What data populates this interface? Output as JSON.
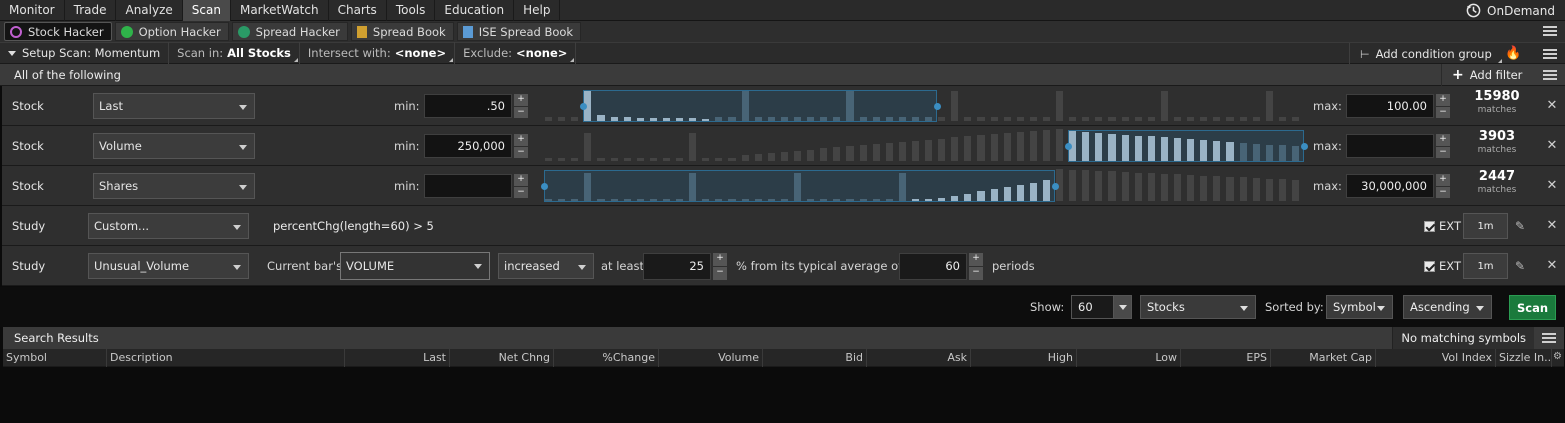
{
  "nav": {
    "tabs": [
      "Monitor",
      "Trade",
      "Analyze",
      "Scan",
      "MarketWatch",
      "Charts",
      "Tools",
      "Education",
      "Help"
    ],
    "active": "Scan",
    "ondemand": "OnDemand"
  },
  "subtabs": [
    {
      "label": "Stock Hacker",
      "icon": "stock-hacker-icon",
      "color": "#c060d0",
      "active": true
    },
    {
      "label": "Option Hacker",
      "icon": "option-hacker-icon",
      "color": "#2fb34a",
      "active": false
    },
    {
      "label": "Spread Hacker",
      "icon": "spread-hacker-icon",
      "color": "#2a9a66",
      "active": false
    },
    {
      "label": "Spread Book",
      "icon": "spread-book-icon",
      "color": "#d0a030",
      "active": false
    },
    {
      "label": "ISE Spread Book",
      "icon": "ise-spread-book-icon",
      "color": "#5b9bd5",
      "active": false
    }
  ],
  "setup": {
    "setup_label": "Setup Scan: Momentum",
    "scan_in_label": "Scan in:",
    "scan_in_value": "All Stocks",
    "intersect_label": "Intersect with:",
    "intersect_value": "<none>",
    "exclude_label": "Exclude:",
    "exclude_value": "<none>",
    "add_condition_group": "Add condition group"
  },
  "conditions_header": {
    "label": "All of the following",
    "add_filter": "Add filter"
  },
  "filters": [
    {
      "type": "Stock",
      "field": "Last",
      "min_label": "min:",
      "min": ".50",
      "max_label": "max:",
      "max": "100.00",
      "matches": "15980",
      "matches_label": "matches"
    },
    {
      "type": "Stock",
      "field": "Volume",
      "min_label": "min:",
      "min": "250,000",
      "max_label": "max:",
      "max": "",
      "matches": "3903",
      "matches_label": "matches"
    },
    {
      "type": "Stock",
      "field": "Shares",
      "min_label": "min:",
      "min": "",
      "max_label": "max:",
      "max": "30,000,000",
      "matches": "2447",
      "matches_label": "matches"
    }
  ],
  "studies": [
    {
      "type": "Study",
      "name": "Custom...",
      "formula": "percentChg(length=60) > 5",
      "ext": "EXT",
      "timeframe": "1m"
    },
    {
      "type": "Study",
      "name": "Unusual_Volume",
      "current_bar": "Current bar's",
      "metric": "VOLUME",
      "direction": "increased",
      "at_least": "at least",
      "percent": "25",
      "from_text": "% from its typical average over",
      "periods_value": "60",
      "periods": "periods",
      "ext": "EXT",
      "timeframe": "1m"
    }
  ],
  "show": {
    "label": "Show:",
    "count": "60",
    "universe": "Stocks",
    "sorted_by_label": "Sorted by:",
    "sort_field": "Symbol",
    "order": "Ascending",
    "scan": "Scan"
  },
  "results": {
    "title": "Search Results",
    "status": "No matching symbols",
    "columns": [
      "Symbol",
      "Description",
      "Last",
      "Net Chng",
      "%Change",
      "Volume",
      "Bid",
      "Ask",
      "High",
      "Low",
      "EPS",
      "Market Cap",
      "Vol Index",
      "Sizzle In..."
    ]
  }
}
